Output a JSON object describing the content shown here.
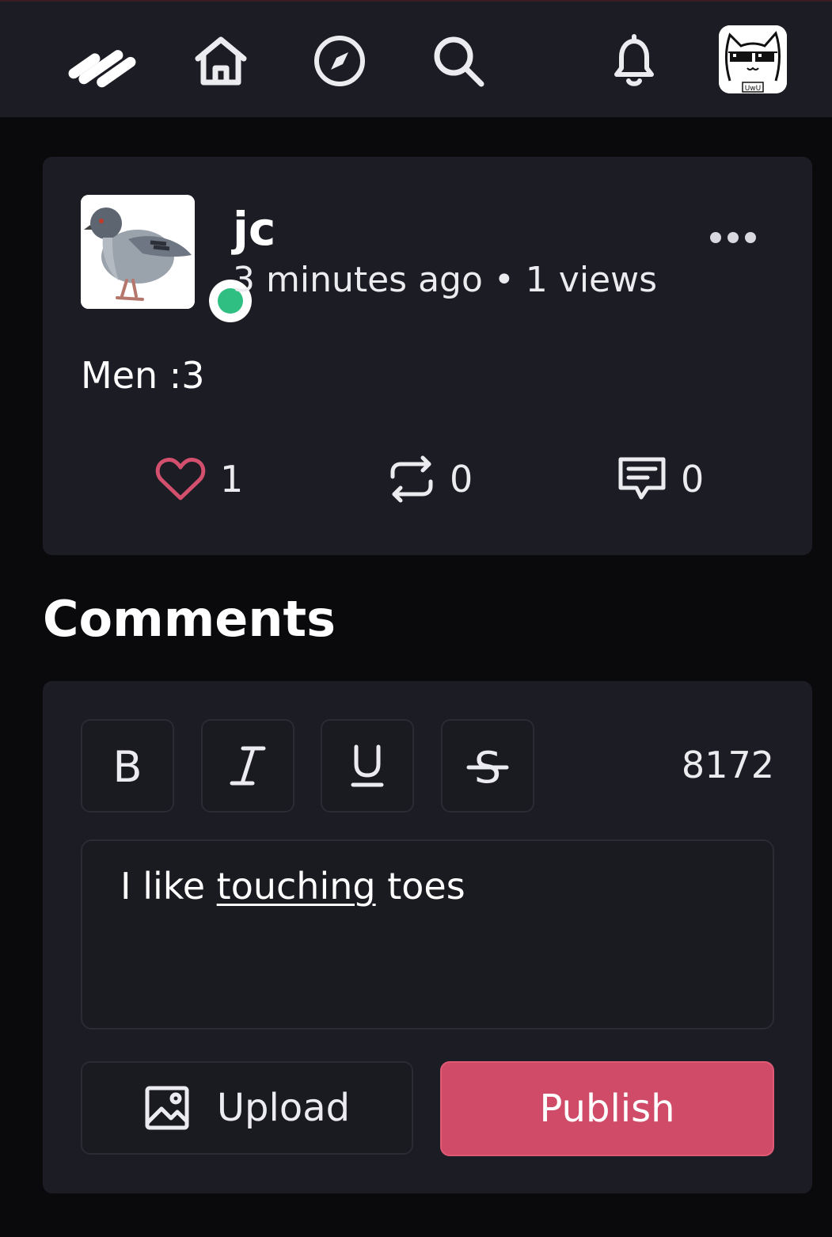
{
  "nav": {
    "items": [
      {
        "icon": "logo-icon"
      },
      {
        "icon": "home-icon"
      },
      {
        "icon": "compass-icon"
      },
      {
        "icon": "search-icon"
      },
      {
        "icon": "bell-icon"
      }
    ],
    "profile_avatar_label": "UwU"
  },
  "post": {
    "author": "jc",
    "meta": "3 minutes ago • 1 views",
    "online": true,
    "text": "Men :3",
    "actions": {
      "likes": "1",
      "reposts": "0",
      "comments": "0"
    }
  },
  "comments": {
    "title": "Comments",
    "toolbar": {
      "bold": "B",
      "italic": "I",
      "underline": "U",
      "strike": "S",
      "remaining_chars": "8172"
    },
    "editor": {
      "before": "I like ",
      "underlined": "touching",
      "after": " toes"
    },
    "upload_label": "Upload",
    "publish_label": "Publish"
  },
  "colors": {
    "background": "#0a0a0d",
    "card": "#1c1c24",
    "accent": "#cf4b67",
    "online": "#2fbf82"
  }
}
